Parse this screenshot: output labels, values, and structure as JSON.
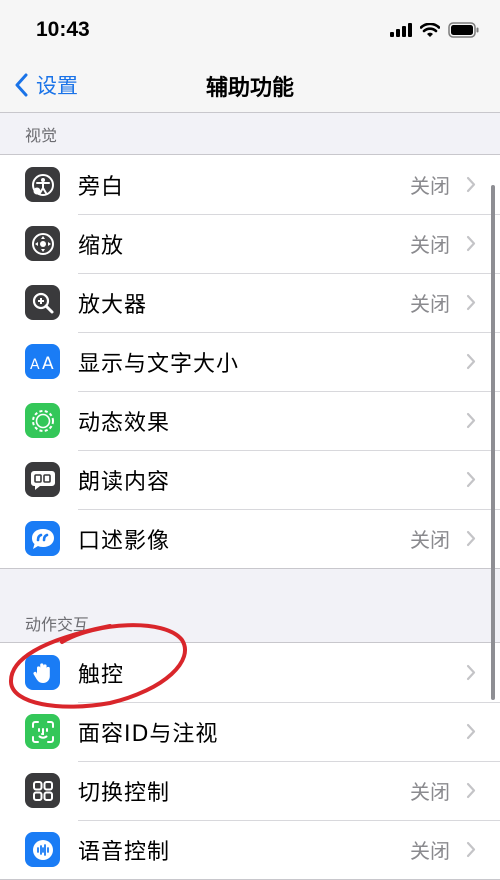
{
  "status_bar": {
    "time": "10:43"
  },
  "nav": {
    "back_label": "设置",
    "title": "辅助功能"
  },
  "sections": [
    {
      "header": "视觉",
      "items": [
        {
          "label": "旁白",
          "value": "关闭",
          "icon": "voiceover-icon",
          "color": "#3a3a3c"
        },
        {
          "label": "缩放",
          "value": "关闭",
          "icon": "zoom-icon",
          "color": "#3a3a3c"
        },
        {
          "label": "放大器",
          "value": "关闭",
          "icon": "magnifier-icon",
          "color": "#3a3a3c"
        },
        {
          "label": "显示与文字大小",
          "value": "",
          "icon": "text-size-icon",
          "color": "#1a7cf5"
        },
        {
          "label": "动态效果",
          "value": "",
          "icon": "motion-icon",
          "color": "#34c759"
        },
        {
          "label": "朗读内容",
          "value": "",
          "icon": "spoken-content-icon",
          "color": "#3a3a3c"
        },
        {
          "label": "口述影像",
          "value": "关闭",
          "icon": "audio-description-icon",
          "color": "#1a7cf5"
        }
      ]
    },
    {
      "header": "动作交互",
      "items": [
        {
          "label": "触控",
          "value": "",
          "icon": "touch-hand-icon",
          "color": "#1a7cf5"
        },
        {
          "label": "面容ID与注视",
          "value": "",
          "icon": "face-id-icon",
          "color": "#34c759"
        },
        {
          "label": "切换控制",
          "value": "关闭",
          "icon": "switch-control-icon",
          "color": "#3a3a3c"
        },
        {
          "label": "语音控制",
          "value": "关闭",
          "icon": "voice-control-icon",
          "color": "#1a7cf5"
        }
      ]
    }
  ],
  "colors": {
    "accent": "#1a73e8",
    "annotation": "#d9262b"
  }
}
